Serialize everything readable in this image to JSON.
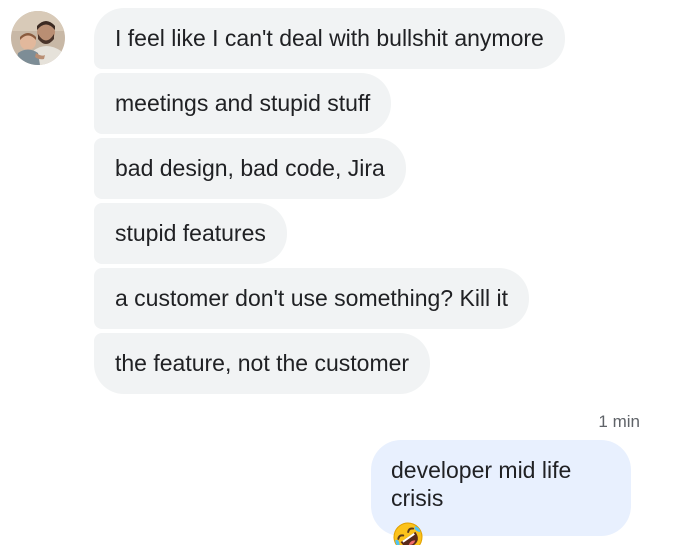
{
  "conversation": {
    "contact": {
      "avatar_icon": "contact-avatar-icon"
    },
    "incoming_messages": [
      "I feel like I can't deal with bullshit anymore",
      "meetings and stupid stuff",
      "bad design, bad code, Jira",
      "stupid features",
      "a customer don't use something? Kill it",
      "the feature, not the customer"
    ],
    "outgoing": {
      "timestamp": "1 min",
      "text": "developer mid life crisis",
      "emoji_icon": "rolling-on-floor-laughing-icon"
    }
  },
  "colors": {
    "incoming_bubble": "#f1f3f4",
    "outgoing_bubble": "#e8f0fe",
    "text": "#202124",
    "timestamp": "#5f6368"
  }
}
